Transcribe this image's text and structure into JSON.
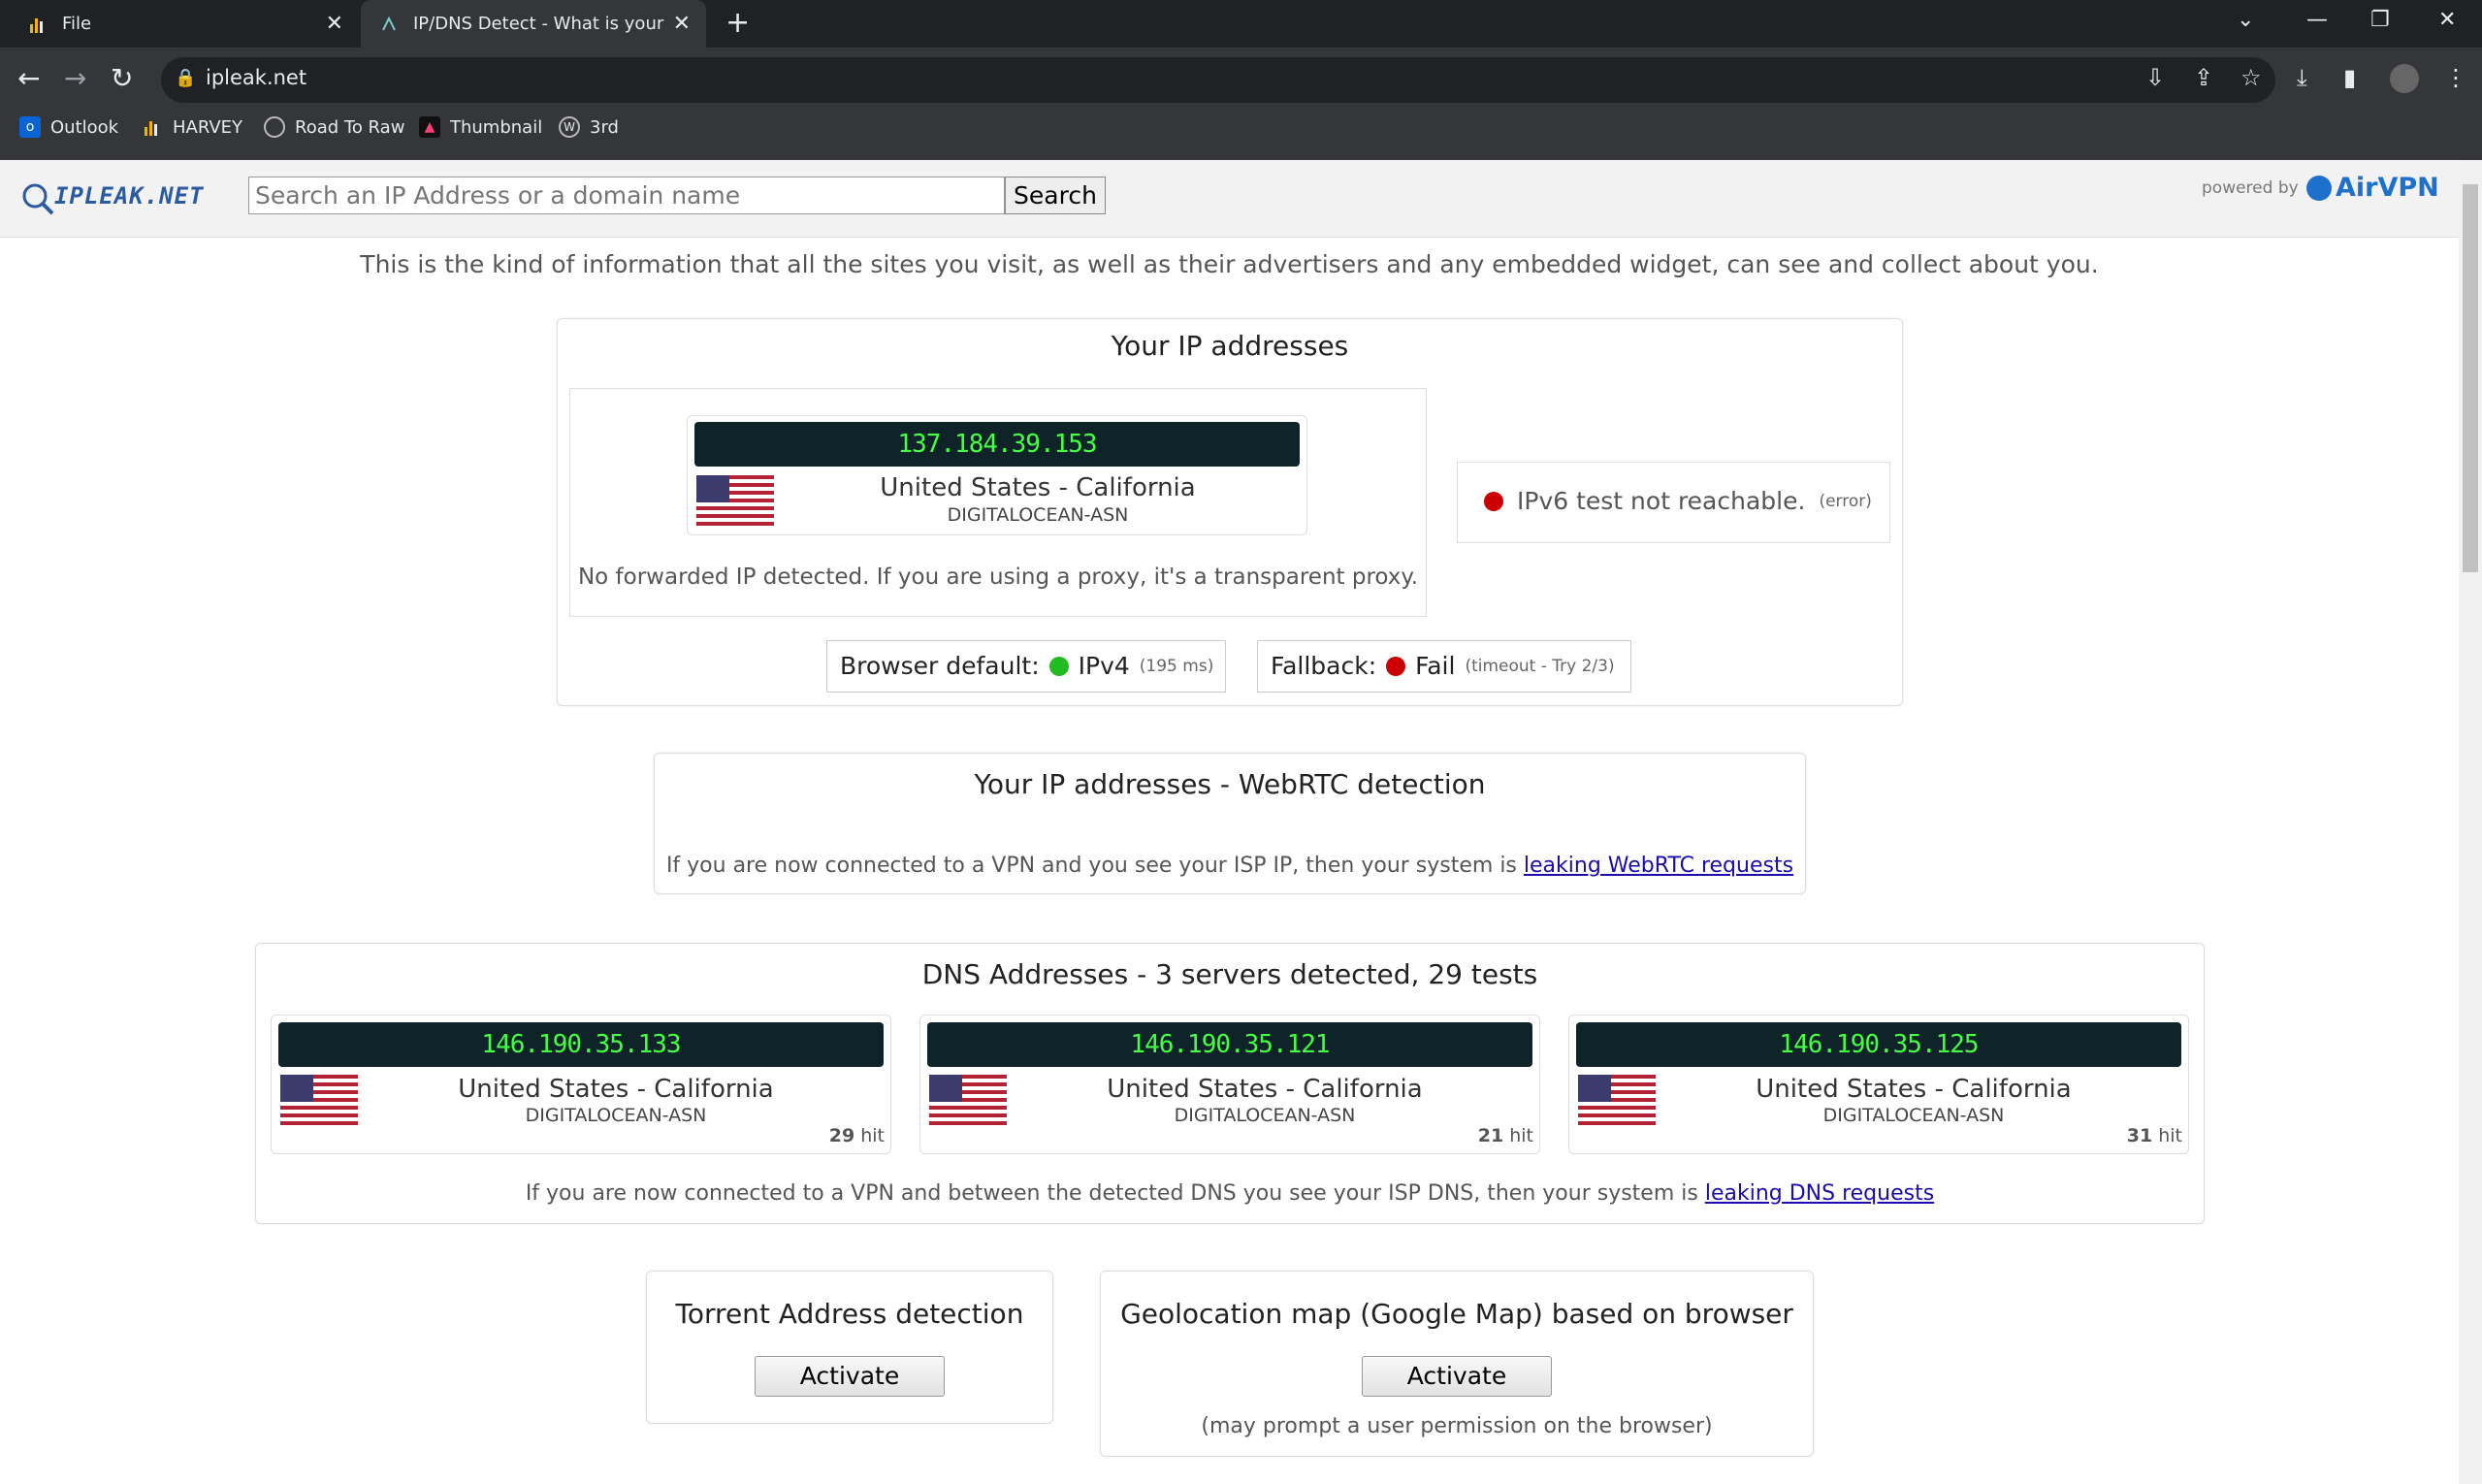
{
  "browser": {
    "tabs": [
      {
        "label": "File",
        "active": false
      },
      {
        "label": "IP/DNS Detect - What is your IP,",
        "active": true
      }
    ],
    "address": "ipleak.net",
    "bookmarks": [
      {
        "label": "Outlook",
        "icon": "outlook-icon"
      },
      {
        "label": "HARVEY",
        "icon": "bar-chart-icon"
      },
      {
        "label": "Road To Raw",
        "icon": "globe-icon"
      },
      {
        "label": "Thumbnail",
        "icon": "app-icon"
      },
      {
        "label": "3rd",
        "icon": "wordpress-icon"
      }
    ]
  },
  "site": {
    "logo": "IPLEAK.NET",
    "search_placeholder": "Search an IP Address or a domain name",
    "search_button": "Search",
    "powered_by": "powered by",
    "brand": "AirVPN",
    "intro": "This is the kind of information that all the sites you visit, as well as their advertisers and any embedded widget, can see and collect about you."
  },
  "ip_section": {
    "title": "Your IP addresses",
    "ip": "137.184.39.153",
    "country": "United States - California",
    "asn": "DIGITALOCEAN-ASN",
    "forwarded_note": "No forwarded IP detected. If you are using a proxy, it's a transparent proxy.",
    "ipv6_status": "IPv6 test not reachable.",
    "ipv6_error": "(error)",
    "browser_default_label": "Browser default:",
    "browser_default_value": "IPv4",
    "browser_default_time": "(195 ms)",
    "fallback_label": "Fallback:",
    "fallback_value": "Fail",
    "fallback_note": "(timeout - Try 2/3)"
  },
  "webrtc": {
    "title": "Your IP addresses - WebRTC detection",
    "note": "If you are now connected to a VPN and you see your ISP IP, then your system is",
    "link": "leaking WebRTC requests"
  },
  "dns": {
    "title": "DNS Addresses - 3 servers detected, 29 tests",
    "servers": [
      {
        "ip": "146.190.35.133",
        "country": "United States - California",
        "asn": "DIGITALOCEAN-ASN",
        "hits": "29",
        "hit_label": "hit"
      },
      {
        "ip": "146.190.35.121",
        "country": "United States - California",
        "asn": "DIGITALOCEAN-ASN",
        "hits": "21",
        "hit_label": "hit"
      },
      {
        "ip": "146.190.35.125",
        "country": "United States - California",
        "asn": "DIGITALOCEAN-ASN",
        "hits": "31",
        "hit_label": "hit"
      }
    ],
    "note": "If you are now connected to a VPN and between the detected DNS you see your ISP DNS, then your system is",
    "link": "leaking DNS requests"
  },
  "torrent": {
    "title": "Torrent Address detection",
    "button": "Activate"
  },
  "geo": {
    "title": "Geolocation map (Google Map) based on browser",
    "button": "Activate",
    "note": "(may prompt a user permission on the browser)"
  },
  "colors": {
    "ip_bar_bg": "#0f2428",
    "ip_text": "#44ff44",
    "red_dot": "#cc0000",
    "green_dot": "#22bb22",
    "link": "#1a0dab"
  }
}
